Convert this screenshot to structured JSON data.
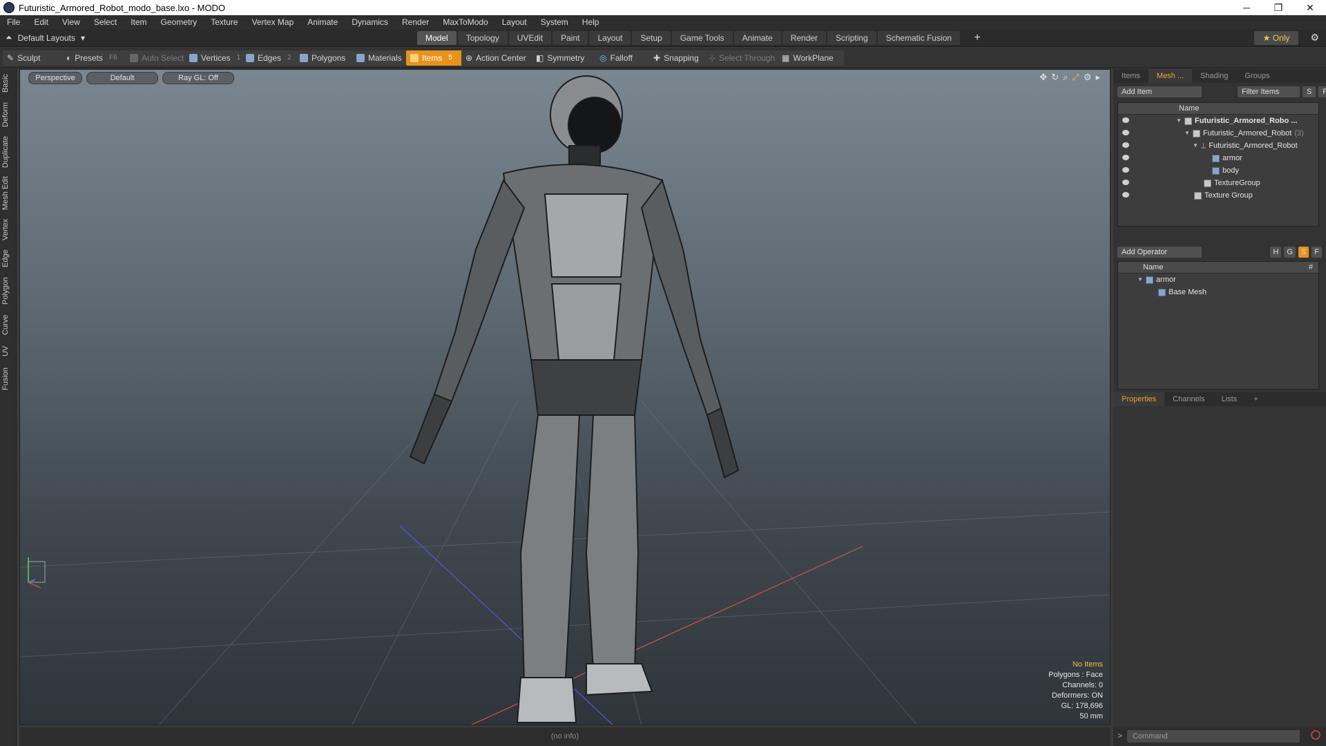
{
  "window": {
    "title": "Futuristic_Armored_Robot_modo_base.lxo - MODO",
    "controls": [
      "─",
      "❐",
      "✕"
    ]
  },
  "menu": [
    "File",
    "Edit",
    "View",
    "Select",
    "Item",
    "Geometry",
    "Texture",
    "Vertex Map",
    "Animate",
    "Dynamics",
    "Render",
    "MaxToModo",
    "Layout",
    "System",
    "Help"
  ],
  "layouts": {
    "label": "Default Layouts"
  },
  "tabs": [
    "Model",
    "Topology",
    "UVEdit",
    "Paint",
    "Layout",
    "Setup",
    "Game Tools",
    "Animate",
    "Render",
    "Scripting",
    "Schematic Fusion"
  ],
  "tabs_active": "Model",
  "only_label": "Only",
  "toolbar": {
    "sculpt": "Sculpt",
    "presets": "Presets",
    "presets_key": "F6",
    "auto_select": "Auto Select",
    "vertices": "Vertices",
    "vertices_key": "1",
    "edges": "Edges",
    "edges_key": "2",
    "polygons": "Polygons",
    "materials": "Materials",
    "items": "Items",
    "items_key": "5",
    "action_center": "Action Center",
    "symmetry": "Symmetry",
    "falloff": "Falloff",
    "snapping": "Snapping",
    "select_through": "Select Through",
    "workplane": "WorkPlane"
  },
  "left_tabs": [
    "Basic",
    "Deform",
    "Duplicate",
    "Mesh Edit",
    "Vertex",
    "Edge",
    "Polygon",
    "Curve",
    "UV",
    "Fusion"
  ],
  "viewport": {
    "view": "Perspective",
    "shading": "Default",
    "raygl": "Ray GL: Off",
    "info": {
      "selection": "No Items",
      "polygons": "Polygons : Face",
      "channels": "Channels: 0",
      "deformers": "Deformers: ON",
      "gl": "GL: 178,696",
      "lens": "50 mm"
    }
  },
  "status": "(no info)",
  "items_panel": {
    "tabs": [
      "Items",
      "Mesh ...",
      "Shading",
      "Groups"
    ],
    "active_tab": "Mesh ...",
    "add_item": "Add Item",
    "filter": "Filter Items",
    "s_btn": "S",
    "f_btn": "F",
    "header_name": "Name",
    "rows": [
      {
        "label": "Futuristic_Armored_Robo ...",
        "indent": 0
      },
      {
        "label": "Futuristic_Armored_Robot",
        "suffix": "(3)",
        "indent": 1
      },
      {
        "label": "Futuristic_Armored_Robot",
        "indent": 2
      },
      {
        "label": "armor",
        "indent": 3
      },
      {
        "label": "body",
        "indent": 3
      },
      {
        "label": "TextureGroup",
        "indent": 2
      },
      {
        "label": "Texture Group",
        "indent": 1
      }
    ]
  },
  "operator_panel": {
    "add_operator": "Add Operator",
    "h_btn": "H",
    "g_btn": "G",
    "s_btn": "S",
    "f_btn": "F",
    "header_name": "Name",
    "header_hash": "#",
    "rows": [
      {
        "label": "armor"
      },
      {
        "label": "Base Mesh"
      }
    ]
  },
  "properties_panel": {
    "tabs": [
      "Properties",
      "Channels",
      "Lists"
    ],
    "active_tab": "Properties"
  },
  "command": {
    "placeholder": "Command"
  },
  "colors": {
    "accent": "#e8921c",
    "selection_text": "#f0c040"
  }
}
